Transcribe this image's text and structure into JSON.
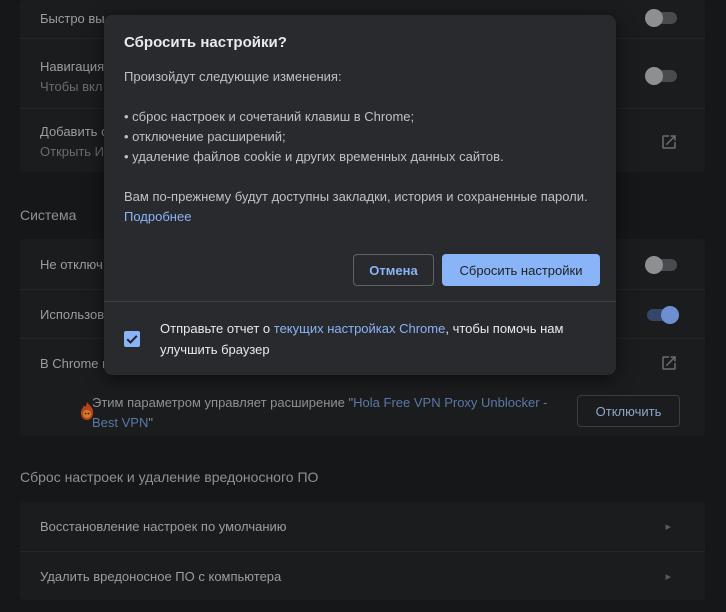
{
  "background": {
    "top_card": {
      "rows": [
        {
          "title": "Быстро вы",
          "toggle": "off"
        },
        {
          "title": "Навигация",
          "subtitle": "Чтобы вкл",
          "toggle": "off"
        },
        {
          "title": "Добавить с",
          "subtitle": "Открыть И",
          "action_icon": "open-in-new-icon"
        }
      ]
    },
    "system_section": {
      "title": "Система",
      "rows": [
        {
          "title": "Не отключ",
          "toggle": "off"
        },
        {
          "title": "Использов",
          "toggle": "on"
        },
        {
          "title": "В Chrome и",
          "action_icon": "open-in-new-icon"
        }
      ],
      "managed": {
        "text_before": "Этим параметром управляет расширение \"",
        "extension_name": "Hola Free VPN Proxy Unblocker - Best VPN",
        "text_after": "\"",
        "disable_button": "Отключить"
      }
    },
    "reset_section": {
      "title": "Сброс настроек и удаление вредоносного ПО",
      "rows": [
        {
          "title": "Восстановление настроек по умолчанию"
        },
        {
          "title": "Удалить вредоносное ПО с компьютера"
        }
      ]
    }
  },
  "dialog": {
    "title": "Сбросить настройки?",
    "intro": "Произойдут следующие изменения:",
    "changes": [
      "• сброс настроек и сочетаний клавиш в Chrome;",
      "• отключение расширений;",
      "• удаление файлов cookie и других временных данных сайтов."
    ],
    "note": "Вам по-прежнему будут доступны закладки, история и сохраненные пароли.",
    "learn_more": "Подробнее",
    "cancel_button": "Отмена",
    "reset_button": "Сбросить настройки",
    "report": {
      "checked": true,
      "text_before": "Отправьте отчет о ",
      "link": "текущих настройках Chrome",
      "text_after": ", чтобы помочь нам улучшить браузер"
    }
  },
  "colors": {
    "accent": "#8ab4f8",
    "dialog_bg": "#292a2d",
    "page_bg": "#161719"
  }
}
